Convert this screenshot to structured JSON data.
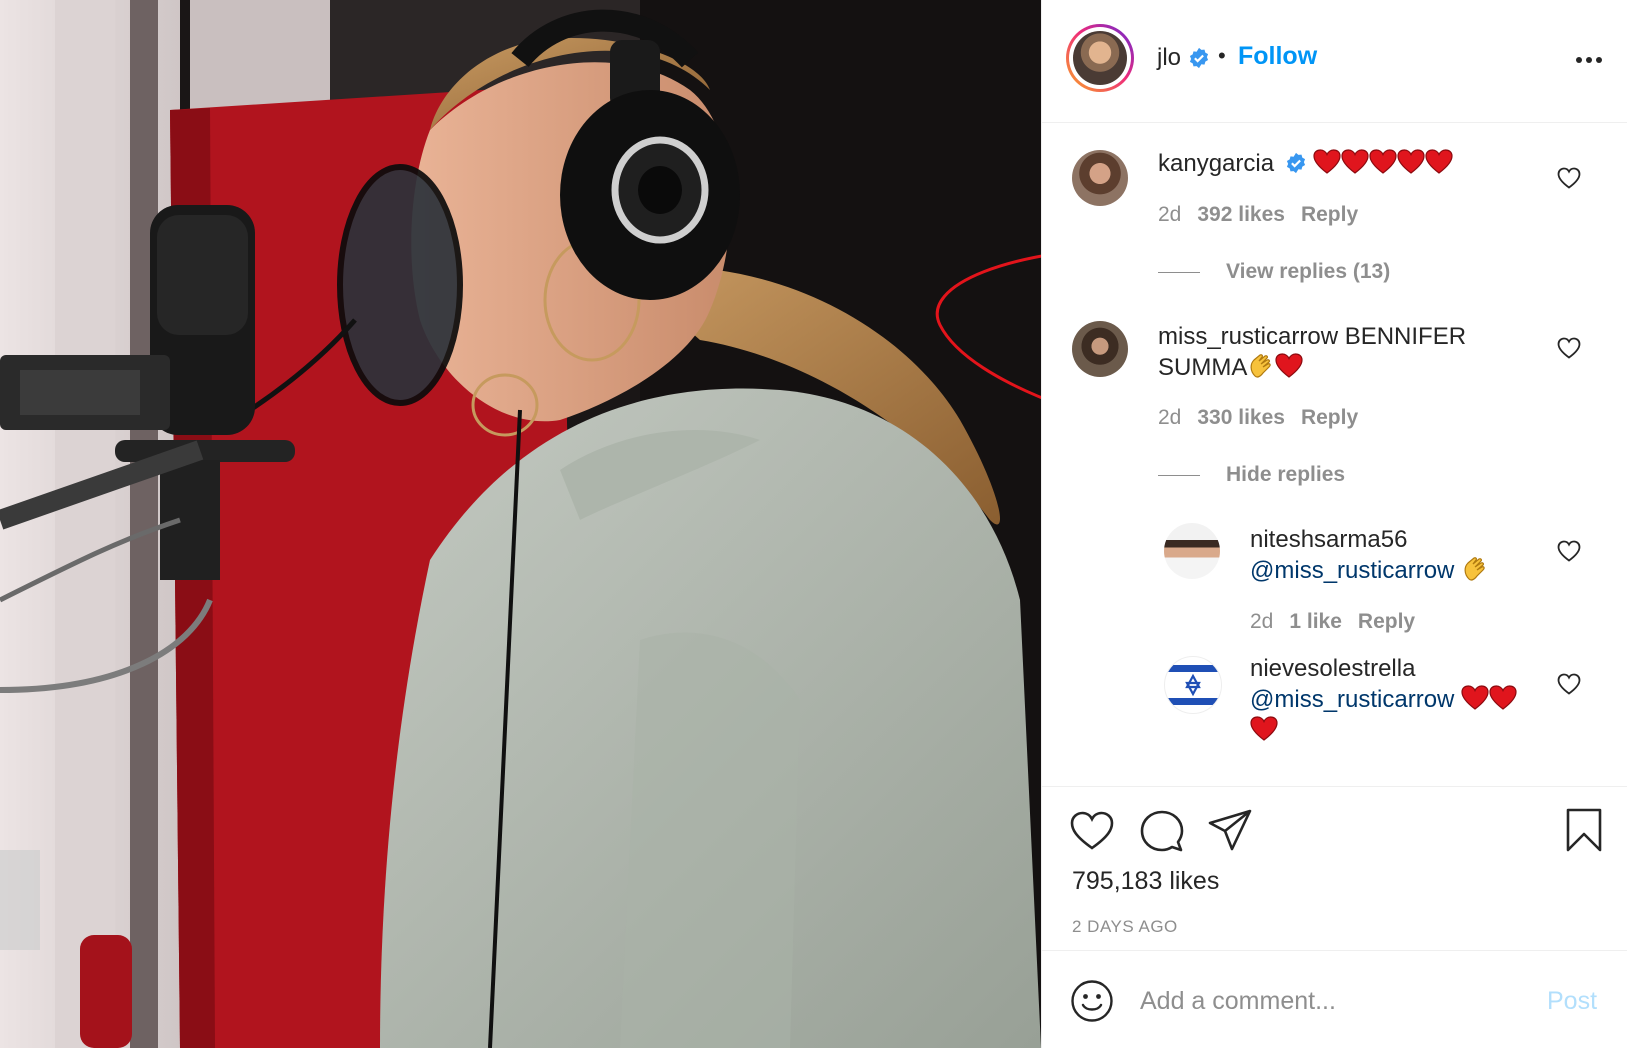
{
  "post": {
    "username": "jlo",
    "follow_label": "Follow",
    "separator": "•"
  },
  "comments": [
    {
      "username": "kanygarcia",
      "verified": true,
      "text": "",
      "emoji": [
        "red-heart",
        "red-heart",
        "red-heart",
        "red-heart",
        "red-heart"
      ],
      "age": "2d",
      "likes": "392 likes",
      "reply_label": "Reply",
      "view_replies_label": "View replies (13)"
    },
    {
      "username": "miss_rusticarrow",
      "text_line1": "BENNIFER",
      "text_line2": "SUMMA",
      "emoji": [
        "clapping-hands",
        "red-heart"
      ],
      "age": "2d",
      "likes": "330 likes",
      "reply_label": "Reply",
      "hide_replies_label": "Hide replies",
      "replies": [
        {
          "username": "niteshsarma56",
          "mention": "@miss_rusticarrow",
          "emoji": [
            "clapping-hands"
          ],
          "age": "2d",
          "likes": "1 like",
          "reply_label": "Reply"
        },
        {
          "username": "nievesolestrella",
          "mention": "@miss_rusticarrow",
          "emoji": [
            "red-heart",
            "red-heart",
            "red-heart"
          ]
        }
      ]
    }
  ],
  "actions": {
    "total_likes": "795,183 likes",
    "date": "2 DAYS AGO",
    "icons": [
      "heart-icon",
      "comment-icon",
      "share-icon",
      "bookmark-icon"
    ]
  },
  "add_comment": {
    "placeholder": "Add a comment...",
    "post_label": "Post"
  },
  "colors": {
    "link_blue": "#0095f6",
    "mention_blue": "#00376b",
    "annotation_red": "#e3141b",
    "muted_text": "#8e8e8e"
  }
}
